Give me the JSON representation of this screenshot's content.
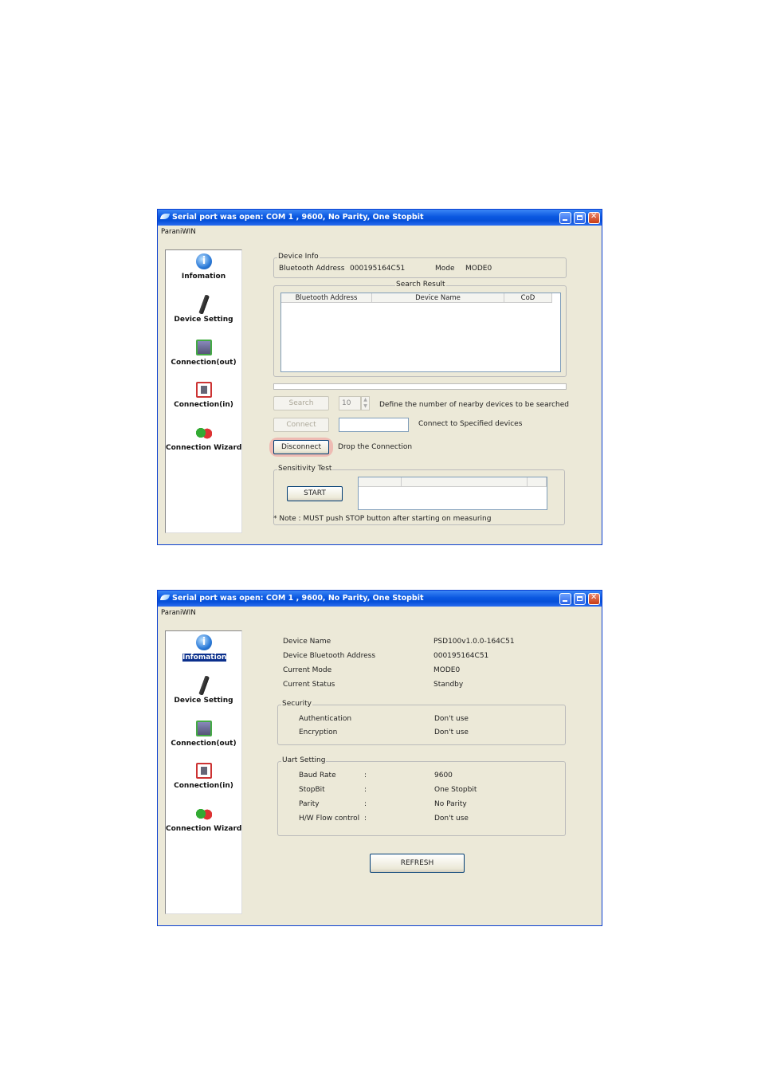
{
  "window": {
    "title": "Serial port was open: COM 1 , 9600, No Parity, One Stopbit",
    "menu": "ParaniWIN"
  },
  "sidebar": {
    "items": [
      {
        "label": "Infomation",
        "icon": "info-icon"
      },
      {
        "label": "Device Setting",
        "icon": "bluetooth-dongle-icon"
      },
      {
        "label": "Connection(out)",
        "icon": "connection-out-icon"
      },
      {
        "label": "Connection(in)",
        "icon": "connection-in-icon"
      },
      {
        "label": "Connection Wizard",
        "icon": "connection-wizard-icon"
      }
    ]
  },
  "connection_in": {
    "device_info": {
      "legend": "Device Info",
      "bt_address_label": "Bluetooth Address",
      "bt_address_value": "000195164C51",
      "mode_label": "Mode",
      "mode_value": "MODE0"
    },
    "search_result": {
      "legend": "Search Result",
      "columns": [
        "Bluetooth Address",
        "Device Name",
        "CoD"
      ]
    },
    "search_button": "Search",
    "search_count": "10",
    "search_desc": "Define the number of nearby devices to be searched",
    "connect_button": "Connect",
    "connect_desc": "Connect to Specified devices",
    "disconnect_button": "Disconnect",
    "disconnect_desc": "Drop the Connection",
    "sensitivity": {
      "legend": "Sensitivity Test",
      "start_button": "START",
      "note": "* Note : MUST push STOP button after starting on measuring"
    }
  },
  "information": {
    "rows": [
      {
        "label": "Device Name",
        "value": "PSD100v1.0.0-164C51"
      },
      {
        "label": "Device Bluetooth Address",
        "value": "000195164C51"
      },
      {
        "label": "Current Mode",
        "value": "MODE0"
      },
      {
        "label": "Current Status",
        "value": "Standby"
      }
    ],
    "security": {
      "legend": "Security",
      "rows": [
        {
          "label": "Authentication",
          "value": "Don't use"
        },
        {
          "label": "Encryption",
          "value": "Don't use"
        }
      ]
    },
    "uart": {
      "legend": "Uart Setting",
      "rows": [
        {
          "label": "Baud Rate",
          "sep": ":",
          "value": "9600"
        },
        {
          "label": "StopBit",
          "sep": ":",
          "value": "One Stopbit"
        },
        {
          "label": "Parity",
          "sep": ":",
          "value": "No Parity"
        },
        {
          "label": "H/W Flow control",
          "sep": ":",
          "value": "Don't use"
        }
      ]
    },
    "refresh_button": "REFRESH"
  }
}
